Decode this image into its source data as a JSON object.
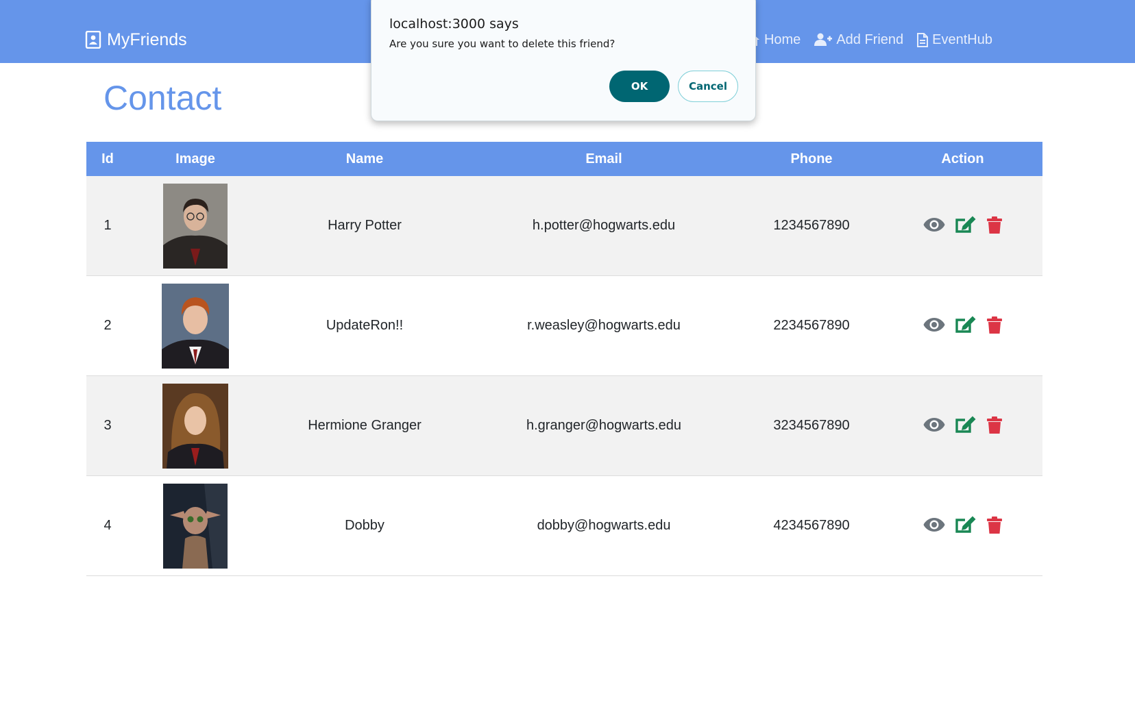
{
  "navbar": {
    "brand": "MyFriends",
    "links": [
      {
        "label": "Home",
        "icon": "home-icon"
      },
      {
        "label": "Add Friend",
        "icon": "user-plus-icon"
      },
      {
        "label": "EventHub",
        "icon": "file-icon"
      }
    ]
  },
  "page": {
    "title": "Contact"
  },
  "table": {
    "headers": [
      "Id",
      "Image",
      "Name",
      "Email",
      "Phone",
      "Action"
    ],
    "rows": [
      {
        "id": "1",
        "name": "Harry Potter",
        "email": "h.potter@hogwarts.edu",
        "phone": "1234567890"
      },
      {
        "id": "2",
        "name": "UpdateRon!!",
        "email": "r.weasley@hogwarts.edu",
        "phone": "2234567890"
      },
      {
        "id": "3",
        "name": "Hermione Granger",
        "email": "h.granger@hogwarts.edu",
        "phone": "3234567890"
      },
      {
        "id": "4",
        "name": "Dobby",
        "email": "dobby@hogwarts.edu",
        "phone": "4234567890"
      }
    ],
    "action_icons": [
      "eye-icon",
      "edit-icon",
      "trash-icon"
    ]
  },
  "dialog": {
    "title": "localhost:3000 says",
    "message": "Are you sure you want to delete this friend?",
    "ok_label": "OK",
    "cancel_label": "Cancel"
  },
  "colors": {
    "primary": "#6595ea",
    "view": "#6c757d",
    "edit": "#198754",
    "delete": "#dc3545",
    "dialog_button": "#006672"
  }
}
